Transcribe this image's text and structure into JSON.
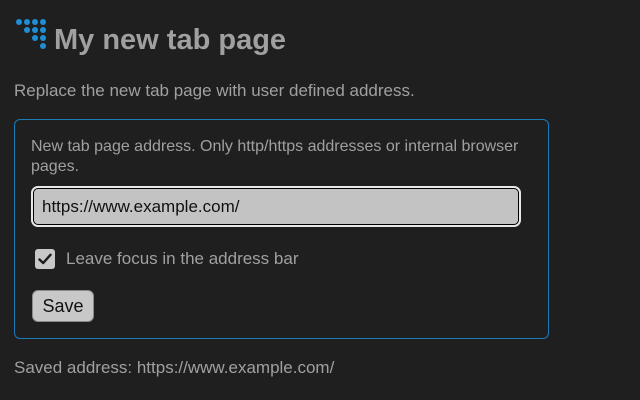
{
  "header": {
    "title": "My new tab page",
    "logo_icon": "dots-triangle-icon",
    "logo_color": "#1e8fd6"
  },
  "description": "Replace the new tab page with user defined address.",
  "form": {
    "address_label": "New tab page address. Only http/https addresses or internal browser pages.",
    "address_value": "https://www.example.com/",
    "checkbox_label": "Leave focus in the address bar",
    "checkbox_checked": true,
    "save_label": "Save",
    "accent_color": "#1a7ab8"
  },
  "status": {
    "saved_text": "Saved address: https://www.example.com/"
  }
}
